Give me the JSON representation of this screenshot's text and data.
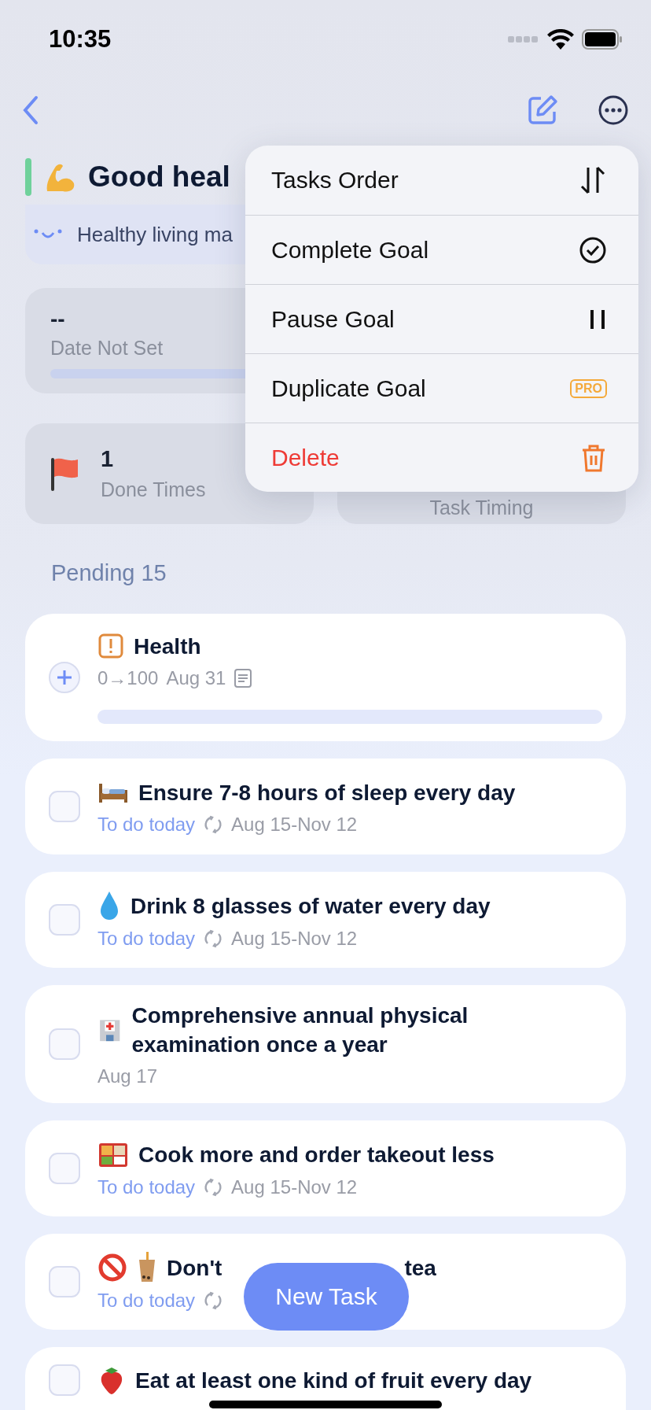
{
  "status_bar": {
    "time": "10:35"
  },
  "goal": {
    "title": "Good heal",
    "description": "Healthy living ma",
    "date": {
      "value": "--",
      "label": "Date Not Set",
      "level": 0
    },
    "stats": [
      {
        "value": "1",
        "label": "Done Times"
      },
      {
        "label": "Task Timing"
      }
    ]
  },
  "menu": {
    "items": [
      {
        "label": "Tasks Order",
        "destructive": false
      },
      {
        "label": "Complete Goal",
        "destructive": false
      },
      {
        "label": "Pause Goal",
        "destructive": false
      },
      {
        "label": "Duplicate Goal",
        "badge": "PRO",
        "destructive": false
      },
      {
        "label": "Delete",
        "destructive": true
      }
    ]
  },
  "section": {
    "title": "Pending 15"
  },
  "tasks": [
    {
      "kind": "goal",
      "title": "Health",
      "range": "0→100",
      "date": "Aug 31",
      "level": 0
    },
    {
      "kind": "task",
      "checked": false,
      "title": "Ensure 7-8 hours of sleep every day",
      "due": "To do today",
      "repeat": true,
      "dates": "Aug 15-Nov 12"
    },
    {
      "kind": "task",
      "checked": false,
      "title": "Drink 8 glasses of water every day",
      "due": "To do today",
      "repeat": true,
      "dates": "Aug 15-Nov 12"
    },
    {
      "kind": "task",
      "checked": false,
      "title": "Comprehensive annual physical examination once a year",
      "dates": "Aug 17",
      "repeat": false
    },
    {
      "kind": "task",
      "checked": false,
      "title": "Cook more and order takeout less",
      "due": "To do today",
      "repeat": true,
      "dates": "Aug 15-Nov 12"
    },
    {
      "kind": "task",
      "checked": false,
      "title": "Don't",
      "title_end": "tea",
      "due": "To do today",
      "repeat": true
    },
    {
      "kind": "task",
      "checked": false,
      "title": "Eat at least one kind of fruit every day"
    }
  ],
  "new_task_button": {
    "label": "New Task"
  }
}
